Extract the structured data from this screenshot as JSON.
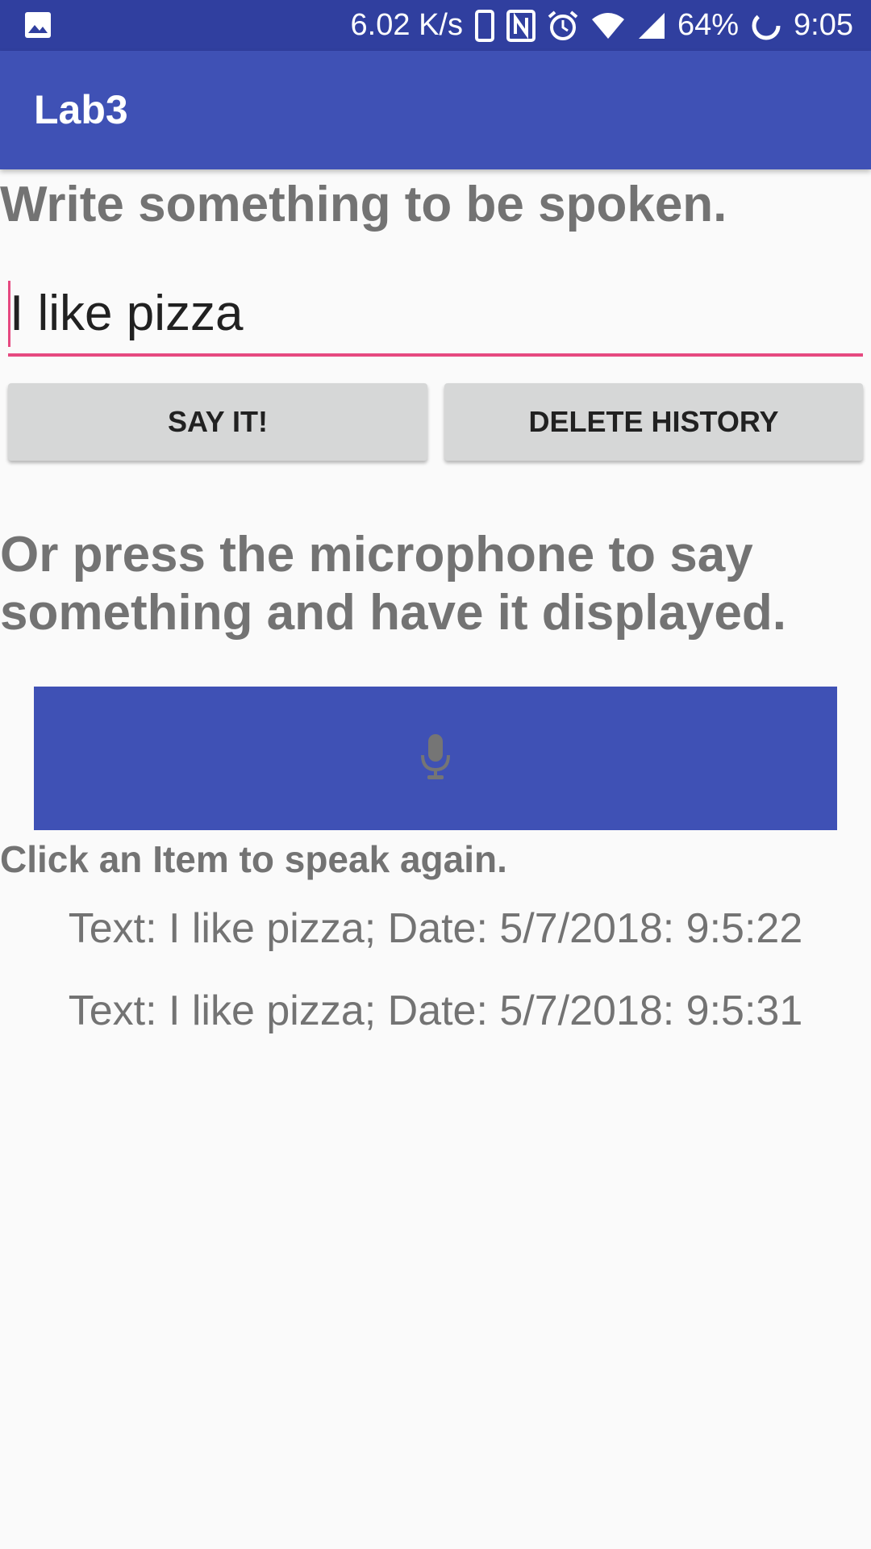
{
  "status_bar": {
    "network_speed": "6.02 K/s",
    "battery": "64%",
    "time": "9:05",
    "icons": [
      "gallery-icon",
      "phone-icon",
      "nfc-icon",
      "alarm-icon",
      "wifi-icon",
      "signal-icon",
      "battery-icon"
    ]
  },
  "app_bar": {
    "title": "Lab3"
  },
  "colors": {
    "primary": "#3f51b5",
    "primary_dark": "#303f9f",
    "accent": "#e64980"
  },
  "write_prompt": "Write something to be spoken.",
  "text_input": {
    "value": "I like pizza"
  },
  "buttons": {
    "say_it": "SAY IT!",
    "delete_history": "DELETE HISTORY"
  },
  "mic_prompt": "Or press the microphone to say something and have it displayed.",
  "mic_button_icon": "microphone-icon",
  "history_prompt": "Click an Item to speak again.",
  "history": [
    {
      "text": "Text: I like pizza; Date: 5/7/2018: 9:5:22"
    },
    {
      "text": "Text: I like pizza; Date: 5/7/2018: 9:5:31"
    }
  ]
}
